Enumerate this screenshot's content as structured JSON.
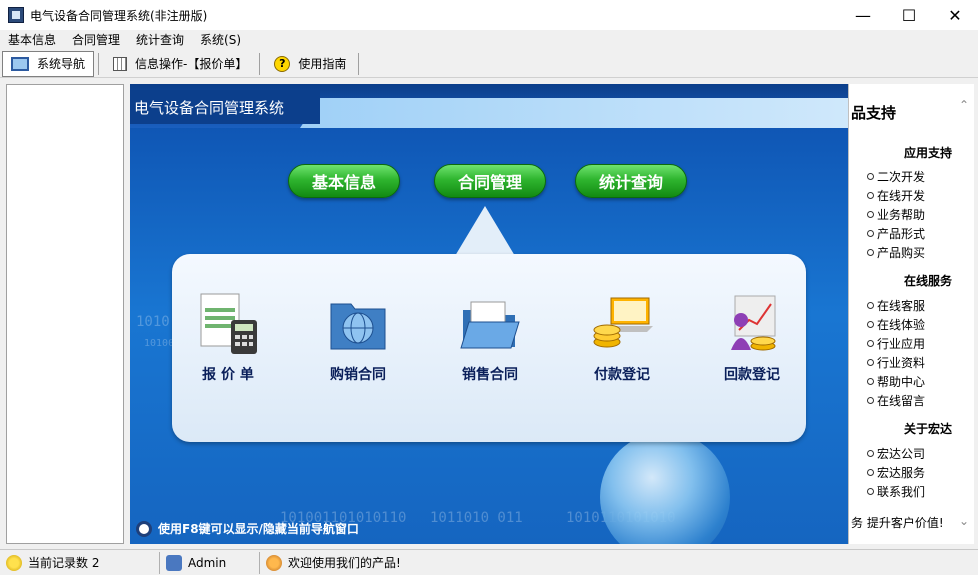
{
  "window": {
    "title": "电气设备合同管理系统(非注册版)",
    "minimize_glyph": "—",
    "maximize_glyph": "☐",
    "close_glyph": "✕"
  },
  "menu": [
    "基本信息",
    "合同管理",
    "统计查询",
    "系统(S)"
  ],
  "toolbar": {
    "nav_label": "系统导航",
    "info_label": "信息操作-【报价单】",
    "guide_label": "使用指南"
  },
  "main": {
    "header_title": "电气设备合同管理系统",
    "nav_buttons": [
      "基本信息",
      "合同管理",
      "统计查询"
    ],
    "modules": [
      "报 价 单",
      "购销合同",
      "销售合同",
      "付款登记",
      "回款登记"
    ],
    "hint": "使用F8键可以显示/隐藏当前导航窗口",
    "bg_numbers": [
      "1010",
      "10100",
      "101001101010110",
      "1011010 011",
      "1010110101010"
    ]
  },
  "right_panel": {
    "title": "品支持",
    "sections": [
      {
        "title": "应用支持",
        "links": [
          "二次开发",
          "在线开发",
          "业务帮助",
          "产品形式",
          "产品购买"
        ]
      },
      {
        "title": "在线服务",
        "links": [
          "在线客服",
          "在线体验",
          "行业应用",
          "行业资料",
          "帮助中心",
          "在线留言"
        ]
      },
      {
        "title": "关于宏达",
        "links": [
          "宏达公司",
          "宏达服务",
          "联系我们"
        ]
      }
    ],
    "footer": "务 提升客户价值!"
  },
  "status": {
    "record_count": "当前记录数 2",
    "user": "Admin",
    "welcome": "欢迎使用我们的产品!"
  },
  "colors": {
    "primary_blue": "#1565c0",
    "button_green": "#2fb52f"
  }
}
